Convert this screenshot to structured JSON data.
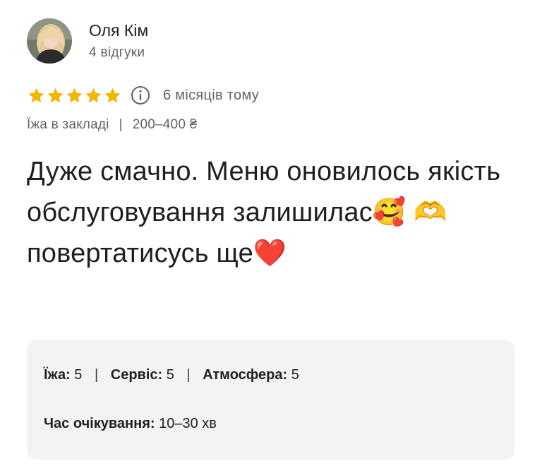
{
  "author": {
    "name": "Оля Кім",
    "reviews_count": "4 відгуки",
    "avatar_icon": "profile-photo"
  },
  "rating": {
    "stars": 5,
    "max_stars": 5,
    "star_color": "#f4b400",
    "info_icon": "info-icon",
    "date": "6 місяців тому"
  },
  "tags": {
    "service_type": "Їжа в закладі",
    "separator": "|",
    "price": "200–400 ₴"
  },
  "review": {
    "text": "Дуже смачно. Меню оновилось якість обслуговування залишилас🥰 🫶 повертатисусь ще❤️"
  },
  "details": {
    "food_label": "Їжа:",
    "food_value": "5",
    "service_label": "Сервіс:",
    "service_value": "5",
    "atmosphere_label": "Атмосфера:",
    "atmosphere_value": "5",
    "separator": "|",
    "wait_label": "Час очікування:",
    "wait_value": "10–30 хв"
  }
}
